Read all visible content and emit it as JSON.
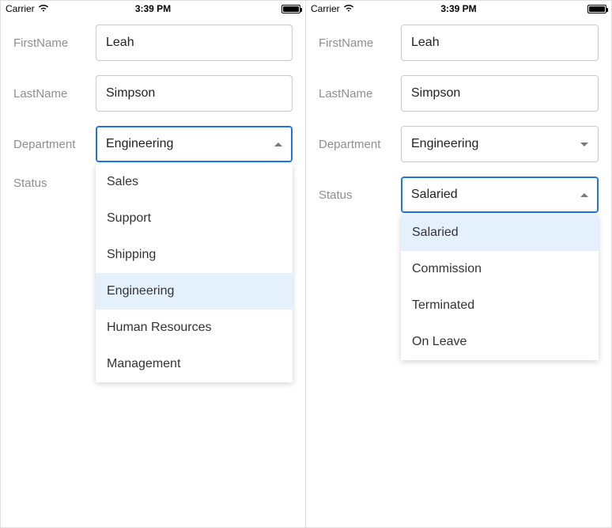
{
  "statusbar": {
    "carrier": "Carrier",
    "time": "3:39 PM"
  },
  "labels": {
    "firstName": "FirstName",
    "lastName": "LastName",
    "department": "Department",
    "status": "Status"
  },
  "values": {
    "firstName": "Leah",
    "lastName": "Simpson",
    "departmentSelected": "Engineering",
    "statusSelected": "Salaried"
  },
  "deviceLeft": {
    "departmentExpanded": true,
    "statusExpanded": false,
    "statusValue": ""
  },
  "deviceRight": {
    "departmentExpanded": false,
    "statusExpanded": true
  },
  "departmentOptions": {
    "0": "Sales",
    "1": "Support",
    "2": "Shipping",
    "3": "Engineering",
    "4": "Human Resources",
    "5": "Management"
  },
  "statusOptions": {
    "0": "Salaried",
    "1": "Commission",
    "2": "Terminated",
    "3": "On Leave"
  }
}
